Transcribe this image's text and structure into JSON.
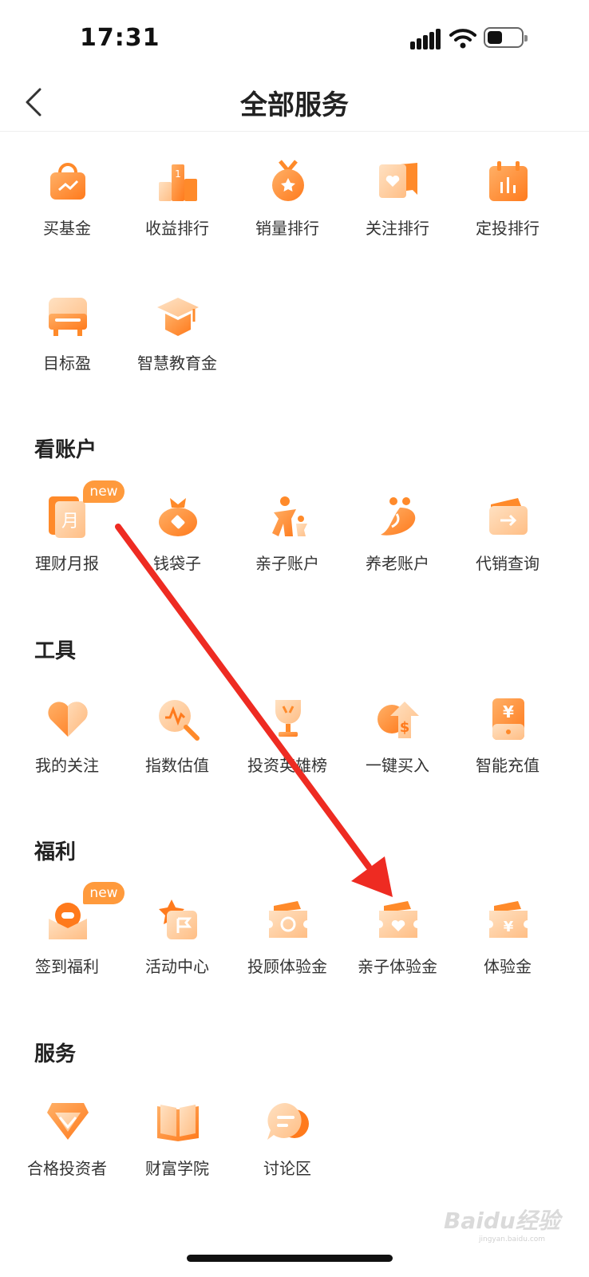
{
  "status_bar": {
    "time": "17:31"
  },
  "header": {
    "title": "全部服务"
  },
  "sections": {
    "fund": {
      "items": [
        {
          "label": "买基金",
          "icon": "shopping-bag-trend-icon"
        },
        {
          "label": "收益排行",
          "icon": "podium-icon"
        },
        {
          "label": "销量排行",
          "icon": "medal-icon"
        },
        {
          "label": "关注排行",
          "icon": "heart-flag-icon"
        },
        {
          "label": "定投排行",
          "icon": "calendar-chart-icon"
        },
        {
          "label": "目标盈",
          "icon": "target-train-icon"
        },
        {
          "label": "智慧教育金",
          "icon": "graduation-cap-icon"
        }
      ]
    },
    "account": {
      "title": "看账户",
      "items": [
        {
          "label": "理财月报",
          "icon": "monthly-report-icon",
          "badge": "new"
        },
        {
          "label": "钱袋子",
          "icon": "money-bag-icon"
        },
        {
          "label": "亲子账户",
          "icon": "parent-child-icon"
        },
        {
          "label": "养老账户",
          "icon": "elderly-icon"
        },
        {
          "label": "代销查询",
          "icon": "wallet-arrow-icon"
        }
      ]
    },
    "tools": {
      "title": "工具",
      "items": [
        {
          "label": "我的关注",
          "icon": "heart-icon"
        },
        {
          "label": "指数估值",
          "icon": "magnifier-pulse-icon"
        },
        {
          "label": "投资英雄榜",
          "icon": "trophy-icon"
        },
        {
          "label": "一键买入",
          "icon": "dollar-arrow-icon"
        },
        {
          "label": "智能充值",
          "icon": "yuan-card-icon"
        }
      ]
    },
    "benefits": {
      "title": "福利",
      "items": [
        {
          "label": "签到福利",
          "icon": "envelope-coin-icon",
          "badge": "new"
        },
        {
          "label": "活动中心",
          "icon": "star-flag-icon"
        },
        {
          "label": "投顾体验金",
          "icon": "ticket-camera-icon"
        },
        {
          "label": "亲子体验金",
          "icon": "ticket-heart-icon"
        },
        {
          "label": "体验金",
          "icon": "ticket-yuan-icon"
        }
      ]
    },
    "services": {
      "title": "服务",
      "items": [
        {
          "label": "合格投资者",
          "icon": "diamond-check-icon"
        },
        {
          "label": "财富学院",
          "icon": "open-book-icon"
        },
        {
          "label": "讨论区",
          "icon": "chat-bubble-icon"
        }
      ]
    }
  },
  "watermark": {
    "text": "Baidu经验",
    "sub": "jingyan.baidu.com"
  },
  "colors": {
    "primary": "#ff8a2a",
    "light": "#ffc58e",
    "arrow": "#ee2b22",
    "badge": "#ff9a3c"
  }
}
